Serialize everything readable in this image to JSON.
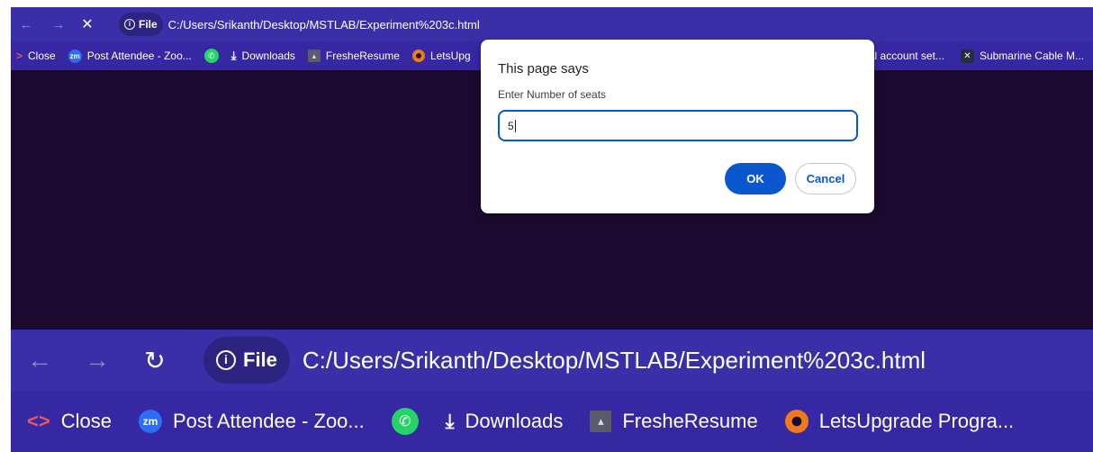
{
  "top_browser": {
    "address": {
      "back_glyph": "←",
      "forward_glyph": "→",
      "stop_glyph": "✕",
      "scheme_label": "File",
      "url": "C:/Users/Srikanth/Desktop/MSTLAB/Experiment%203c.html"
    },
    "bookmarks": {
      "left": [
        {
          "label": "Close",
          "icon": "chevron-right-icon"
        },
        {
          "label": "Post Attendee - Zoo...",
          "icon": "zoom-icon"
        },
        {
          "label": "",
          "icon": "whatsapp-icon"
        },
        {
          "label": "Downloads",
          "icon": "download-icon"
        },
        {
          "label": "FresheResume",
          "icon": "freshersume-icon"
        },
        {
          "label": "LetsUpg",
          "icon": "letsupgrade-icon"
        }
      ],
      "right": [
        {
          "label": "ral account set...",
          "icon": ""
        },
        {
          "label": "Submarine Cable M...",
          "icon": "submarine-cable-icon"
        }
      ]
    }
  },
  "dialog": {
    "title": "This page says",
    "message": "Enter Number of seats",
    "input_value": "5",
    "ok_label": "OK",
    "cancel_label": "Cancel"
  },
  "bottom_browser": {
    "address": {
      "back_glyph": "←",
      "forward_glyph": "→",
      "reload_glyph": "↻",
      "scheme_label": "File",
      "url": "C:/Users/Srikanth/Desktop/MSTLAB/Experiment%203c.html"
    },
    "bookmarks": [
      {
        "label": "Close",
        "icon": "chevron-right-icon"
      },
      {
        "label": "Post Attendee - Zoo...",
        "icon": "zoom-icon"
      },
      {
        "label": "",
        "icon": "whatsapp-icon"
      },
      {
        "label": "Downloads",
        "icon": "download-icon"
      },
      {
        "label": "FresheResume",
        "icon": "freshersume-icon"
      },
      {
        "label": "LetsUpgrade Progra...",
        "icon": "letsupgrade-icon"
      }
    ]
  },
  "colors": {
    "address_bar": "#3a2fa8",
    "bookmark_bar": "#3627a3",
    "page_background": "#1b0a30",
    "dialog_accent": "#0b57d0"
  }
}
